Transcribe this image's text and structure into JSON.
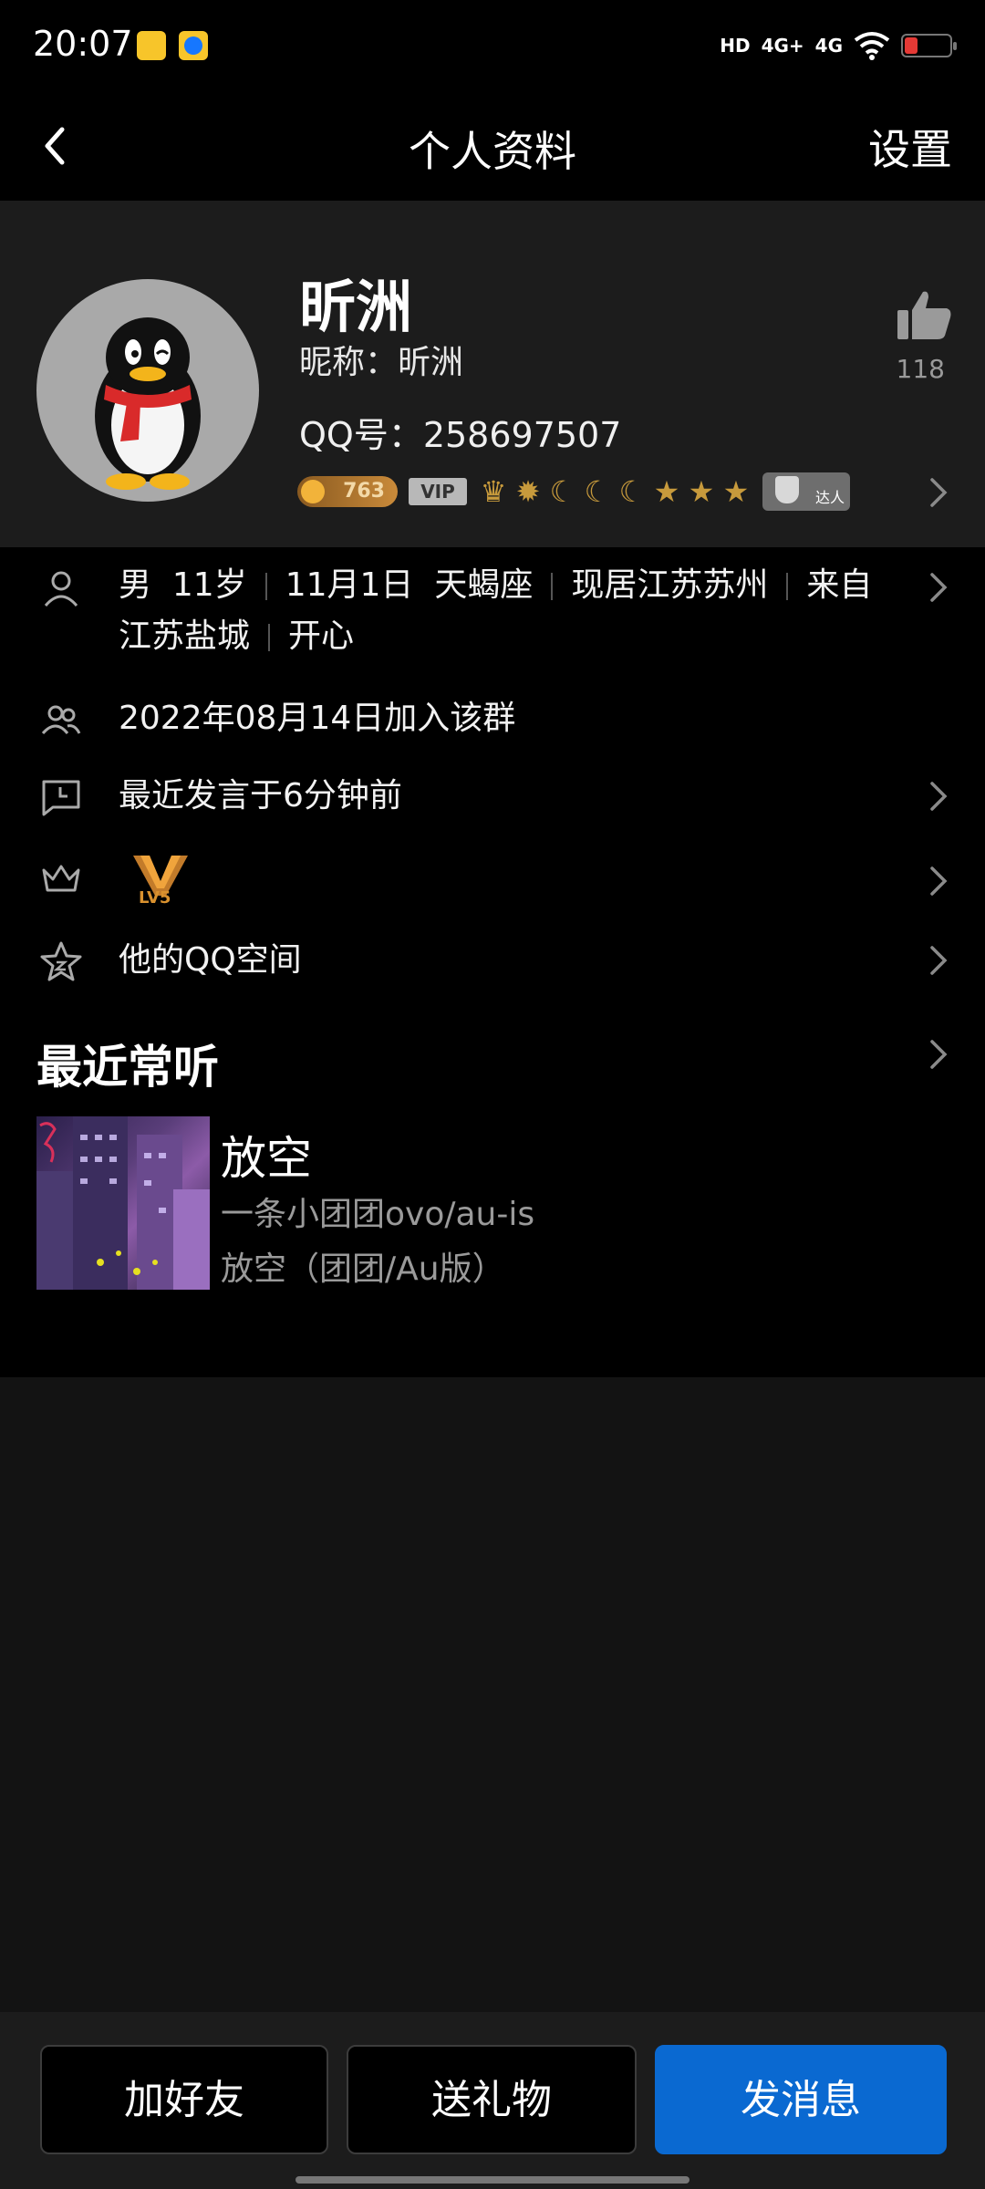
{
  "status_bar": {
    "time": "20:07",
    "app_icons": [
      "meituan-icon",
      "alipay-icon"
    ],
    "hd_label": "HD",
    "signal_1": "4G+",
    "signal_2": "4G"
  },
  "nav": {
    "title": "个人资料",
    "settings": "设置"
  },
  "profile": {
    "name": "昕洲",
    "nickname": "昵称：昕洲",
    "qq_number": "QQ号：258697507",
    "coin_value": "763",
    "vip_label": "VIP",
    "daren_label": "达人",
    "likes": "118"
  },
  "info": {
    "gender": "男",
    "age": "11岁",
    "birthday": "11月1日",
    "constellation": "天蝎座",
    "location": "现居江苏苏州",
    "hometown_prefix": "来自",
    "hometown": "江苏盐城",
    "mood": "开心",
    "join_date": "2022年08月14日加入该群",
    "last_speak": "最近发言于6分钟前",
    "level_badge": "LV5",
    "qzone": "他的QQ空间"
  },
  "music": {
    "section_title": "最近常听",
    "song_name": "放空",
    "artist": "一条小团团ovo/au-is",
    "album": "放空（团团/Au版）"
  },
  "actions": {
    "add_friend": "加好友",
    "send_gift": "送礼物",
    "send_message": "发消息"
  },
  "colors": {
    "primary_button": "#0a69d1",
    "background": "#000000",
    "card": "#1c1c1c"
  }
}
